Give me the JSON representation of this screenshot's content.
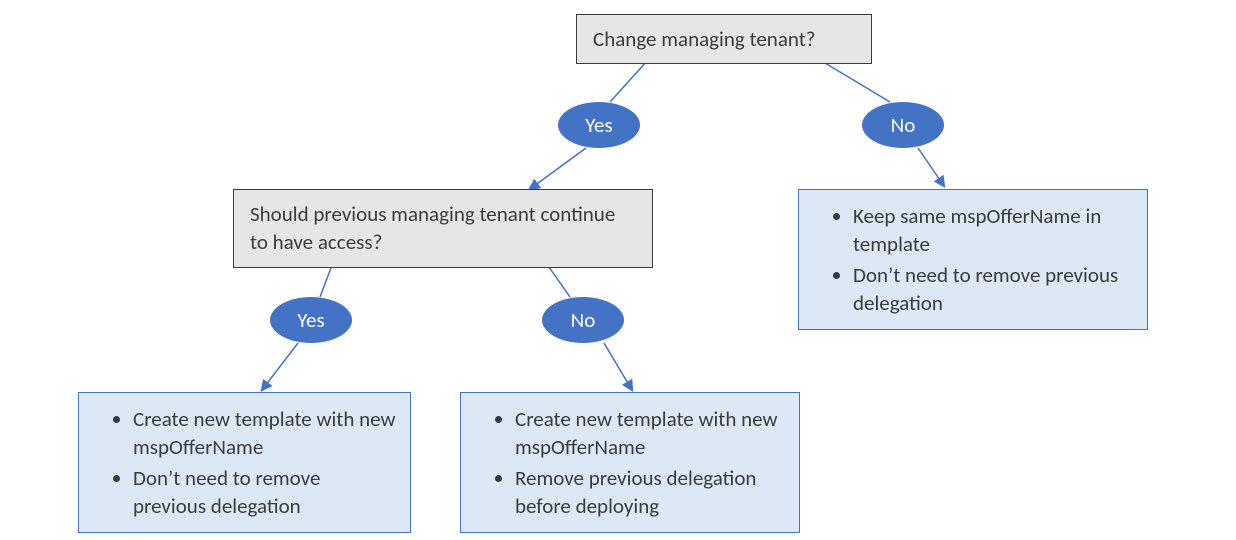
{
  "chart_data": {
    "type": "flowchart",
    "nodes": [
      {
        "id": "q1",
        "kind": "decision",
        "text": "Change managing tenant?"
      },
      {
        "id": "q1yes",
        "kind": "label",
        "text": "Yes"
      },
      {
        "id": "q1no",
        "kind": "label",
        "text": "No"
      },
      {
        "id": "q2",
        "kind": "decision",
        "text": "Should previous managing tenant continue to have access?"
      },
      {
        "id": "q2yes",
        "kind": "label",
        "text": "Yes"
      },
      {
        "id": "q2no",
        "kind": "label",
        "text": "No"
      },
      {
        "id": "ansA",
        "kind": "result",
        "bullets": [
          "Keep same mspOfferName in template",
          "Don’t need to remove previous delegation"
        ]
      },
      {
        "id": "ansB",
        "kind": "result",
        "bullets": [
          "Create new template with new mspOfferName",
          "Don’t need to remove previous delegation"
        ]
      },
      {
        "id": "ansC",
        "kind": "result",
        "bullets": [
          "Create new template with new mspOfferName",
          "Remove previous delegation before deploying"
        ]
      }
    ],
    "edges": [
      {
        "from": "q1",
        "to": "q2",
        "label": "Yes"
      },
      {
        "from": "q1",
        "to": "ansA",
        "label": "No"
      },
      {
        "from": "q2",
        "to": "ansB",
        "label": "Yes"
      },
      {
        "from": "q2",
        "to": "ansC",
        "label": "No"
      }
    ]
  },
  "q1": {
    "text": "Change managing tenant?"
  },
  "q1yes": {
    "text": "Yes"
  },
  "q1no": {
    "text": "No"
  },
  "q2": {
    "text": "Should previous managing tenant continue to have access?"
  },
  "q2yes": {
    "text": "Yes"
  },
  "q2no": {
    "text": "No"
  },
  "ansA": {
    "b1": "Keep same mspOfferName in template",
    "b2": "Don’t need to remove previous delegation"
  },
  "ansB": {
    "b1": "Create new template with new mspOfferName",
    "b2": "Don’t need to remove previous delegation"
  },
  "ansC": {
    "b1": "Create new template with new mspOfferName",
    "b2": "Remove previous delegation before deploying"
  }
}
